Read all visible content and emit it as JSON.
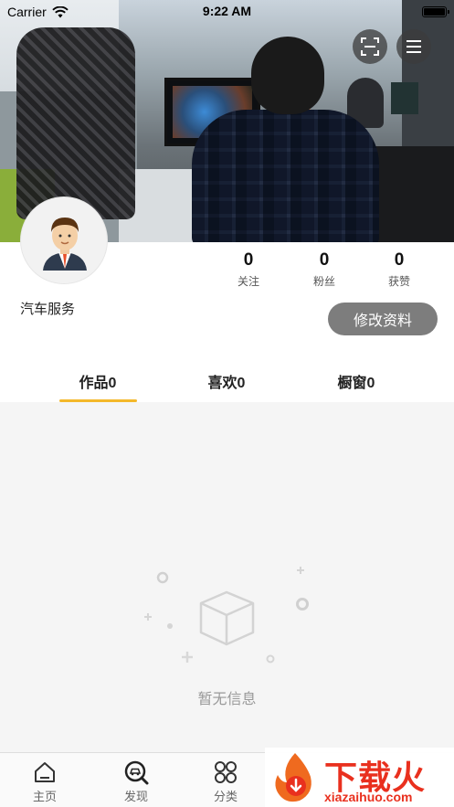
{
  "status_bar": {
    "carrier": "Carrier",
    "time": "9:22 AM"
  },
  "cover": {
    "scan_icon": "scan-icon",
    "menu_icon": "menu-icon"
  },
  "profile": {
    "username": "汽车服务",
    "edit_label": "修改资料",
    "stats": [
      {
        "value": "0",
        "label": "关注"
      },
      {
        "value": "0",
        "label": "粉丝"
      },
      {
        "value": "0",
        "label": "获赞"
      }
    ]
  },
  "tabs": [
    {
      "label": "作品0",
      "active": true
    },
    {
      "label": "喜欢0",
      "active": false
    },
    {
      "label": "橱窗0",
      "active": false
    }
  ],
  "empty": {
    "text": "暂无信息",
    "icon": "empty-box-icon"
  },
  "tabbar": [
    {
      "label": "主页",
      "icon": "home-icon"
    },
    {
      "label": "发现",
      "icon": "discover-icon"
    },
    {
      "label": "分类",
      "icon": "category-icon"
    }
  ],
  "watermark": {
    "main": "下载火",
    "sub": "xiazaihuo.com"
  },
  "colors": {
    "accent": "#f4b82a",
    "edit_button": "#7d7d7d",
    "content_bg": "#f5f5f5",
    "watermark": "#e9301e"
  }
}
